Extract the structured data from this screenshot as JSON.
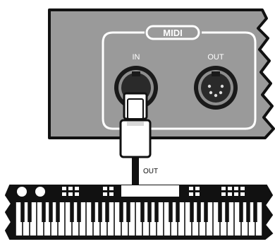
{
  "interface_panel": {
    "group_label": "MIDI",
    "ports": [
      {
        "label": "IN"
      },
      {
        "label": "OUT"
      }
    ]
  },
  "cable": {
    "label": "OUT"
  },
  "keyboard": {
    "white_key_count": 35
  }
}
